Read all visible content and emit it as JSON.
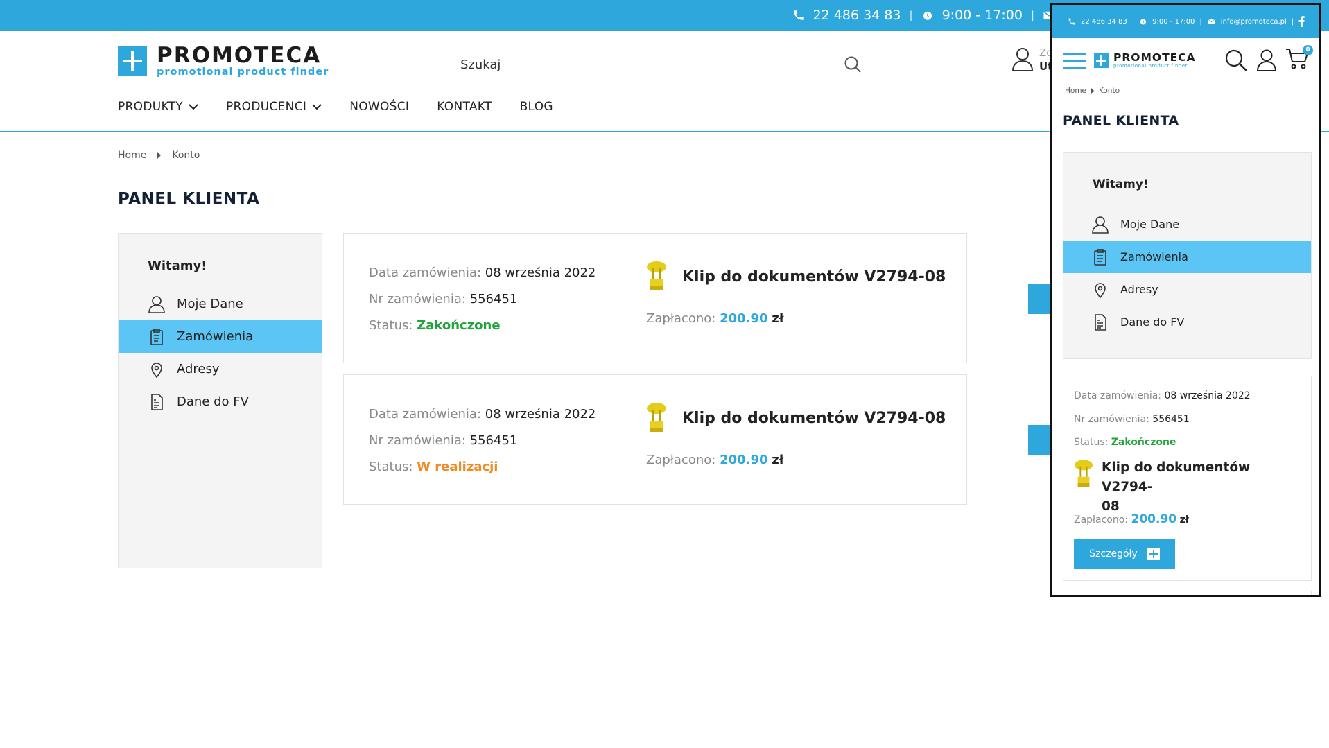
{
  "topbar": {
    "phone": "22 486 34 83",
    "hours": "9:00 - 17:00"
  },
  "logo": {
    "name": "PROMOTECA",
    "tagline": "promotional product finder"
  },
  "search": {
    "placeholder": "Szukaj"
  },
  "account": {
    "line1": "Zc",
    "line2": "Ut"
  },
  "nav": [
    {
      "label": "PRODUKTY",
      "dropdown": true
    },
    {
      "label": "PRODUCENCI",
      "dropdown": true
    },
    {
      "label": "NOWOŚCI",
      "dropdown": false
    },
    {
      "label": "KONTAKT",
      "dropdown": false
    },
    {
      "label": "BLOG",
      "dropdown": false
    }
  ],
  "breadcrumb": [
    "Home",
    "Konto"
  ],
  "page_title": "PANEL KLIENTA",
  "sidebar": {
    "welcome": "Witamy!",
    "items": [
      {
        "label": "Moje Dane",
        "icon": "user-icon",
        "active": false
      },
      {
        "label": "Zamówienia",
        "icon": "clipboard-icon",
        "active": true
      },
      {
        "label": "Adresy",
        "icon": "location-pin-icon",
        "active": false
      },
      {
        "label": "Dane do FV",
        "icon": "invoice-document-icon",
        "active": false
      }
    ]
  },
  "orders": [
    {
      "date_label": "Data zamówienia:",
      "date": "08 września 2022",
      "number_label": "Nr zamówienia:",
      "number": "556451",
      "status_label": "Status:",
      "status": "Zakończone",
      "status_type": "done",
      "product": "Klip do dokumentów V2794-08",
      "paid_label": "Zapłacono:",
      "amount": "200.90",
      "currency": "zł"
    },
    {
      "date_label": "Data zamówienia:",
      "date": "08 września 2022",
      "number_label": "Nr zamówienia:",
      "number": "556451",
      "status_label": "Status:",
      "status": "W realizacji",
      "status_type": "progress",
      "product": "Klip do dokumentów V2794-08",
      "paid_label": "Zapłacono:",
      "amount": "200.90",
      "currency": "zł"
    }
  ],
  "mobile": {
    "topbar": {
      "phone": "22 486 34 83",
      "hours": "9:00 - 17:00",
      "email": "info@promoteca.pl"
    },
    "cart_count": "0",
    "product_line1": "Klip do dokumentów V2794-",
    "product_line2": "08",
    "details_button": "Szczegóły"
  },
  "colors": {
    "brand": "#2ea8dc",
    "active_menu": "#5bc6f5",
    "status_done": "#22a33a",
    "status_progress": "#f08a24"
  }
}
